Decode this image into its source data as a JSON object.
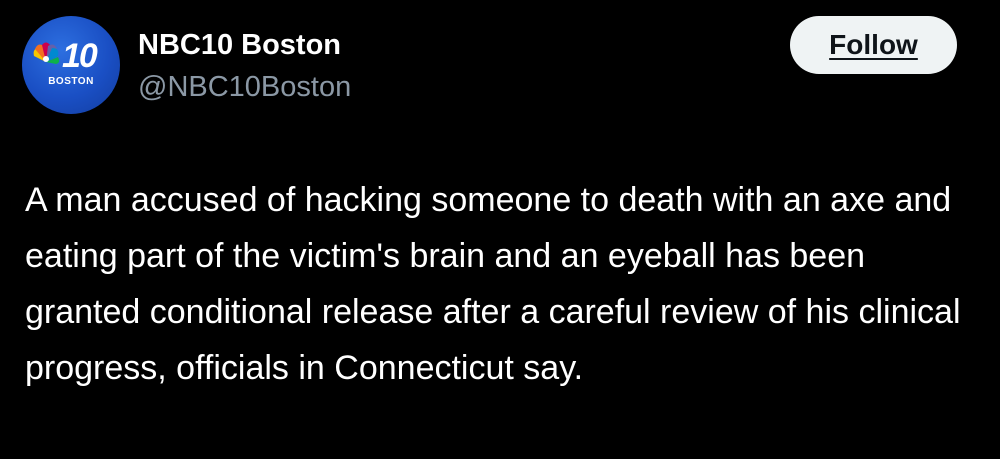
{
  "post": {
    "author": {
      "display_name": "NBC10 Boston",
      "handle": "@NBC10Boston",
      "avatar": {
        "icon": "nbc-peacock-logo-icon",
        "logo_number": "10",
        "logo_text": "BOSTON"
      }
    },
    "follow_label": "Follow",
    "text": "A man accused of hacking someone to death with an axe and eating part of the victim's brain and an eyeball has been granted conditional release after a careful review of his clinical progress, officials in Connecticut say."
  },
  "colors": {
    "background": "#000000",
    "primary_text": "#ffffff",
    "secondary_text": "#8b98a5",
    "follow_button_bg": "#eff3f4",
    "avatar_blue": "#1a4fc4"
  }
}
